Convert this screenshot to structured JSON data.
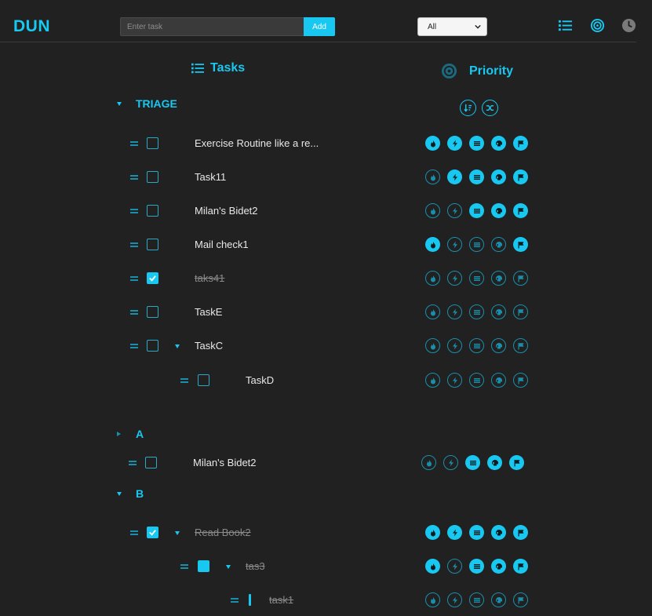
{
  "app": {
    "title": "DUN"
  },
  "header": {
    "input_placeholder": "Enter task",
    "add_label": "Add",
    "filter_selected": "All",
    "icons": [
      "list-icon",
      "target-icon",
      "clock-icon"
    ]
  },
  "columns": {
    "tasks_label": "Tasks",
    "priority_label": "Priority"
  },
  "colors": {
    "accent": "#18c8f0",
    "dim": "#1a8fab",
    "background": "#212121"
  },
  "priority_icon_names": [
    "fire-icon",
    "bolt-icon",
    "lines-icon",
    "skull-icon",
    "flag-icon"
  ],
  "groups": [
    {
      "name": "TRIAGE",
      "expanded": true,
      "tasks": [
        {
          "text": "Exercise Routine like a re...",
          "checked": false,
          "done": false,
          "priority": [
            1,
            1,
            1,
            1,
            1
          ]
        },
        {
          "text": "Task11",
          "checked": false,
          "done": false,
          "priority": [
            0,
            1,
            1,
            1,
            1
          ]
        },
        {
          "text": "Milan's Bidet2",
          "checked": false,
          "done": false,
          "priority": [
            0,
            0,
            1,
            1,
            1
          ]
        },
        {
          "text": "Mail check1",
          "checked": false,
          "done": false,
          "priority": [
            1,
            0,
            0,
            0,
            1
          ]
        },
        {
          "text": "taks41",
          "checked": true,
          "done": true,
          "priority": [
            0,
            0,
            0,
            0,
            0
          ]
        },
        {
          "text": "TaskE",
          "checked": false,
          "done": false,
          "priority": [
            0,
            0,
            0,
            0,
            0
          ]
        },
        {
          "text": "TaskC",
          "checked": false,
          "done": false,
          "has_children": true,
          "priority": [
            0,
            0,
            0,
            0,
            0
          ]
        },
        {
          "text": "TaskD",
          "checked": false,
          "done": false,
          "indent": 1,
          "priority": [
            0,
            0,
            0,
            0,
            0
          ]
        }
      ]
    },
    {
      "name": "A",
      "expanded": false,
      "tasks": [
        {
          "text": "Milan's Bidet2",
          "checked": false,
          "done": false,
          "priority": [
            0,
            0,
            1,
            1,
            1
          ]
        }
      ]
    },
    {
      "name": "B",
      "expanded": true,
      "tasks": [
        {
          "text": "Read Book2",
          "checked": true,
          "done": true,
          "has_children": true,
          "priority": [
            1,
            1,
            1,
            1,
            1
          ]
        },
        {
          "text": "tas3",
          "checked": "partial",
          "done": true,
          "has_children": true,
          "indent": 1,
          "priority": [
            1,
            0,
            1,
            1,
            1
          ]
        },
        {
          "text": "task1",
          "checked": "bar",
          "done": true,
          "indent": 2,
          "priority": [
            0,
            0,
            0,
            0,
            0
          ]
        }
      ]
    }
  ]
}
